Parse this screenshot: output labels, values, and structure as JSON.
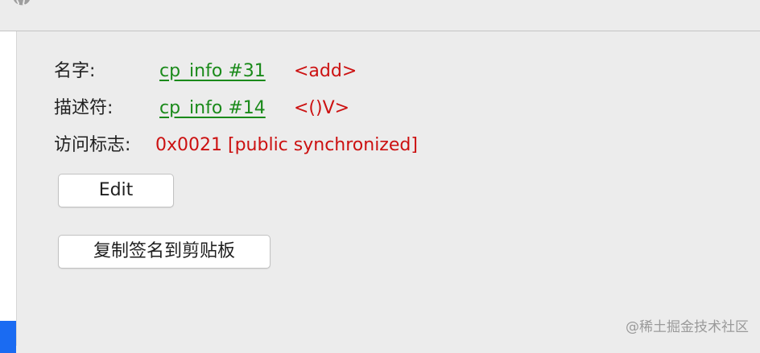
{
  "fields": {
    "name": {
      "label": "名字:",
      "link": "cp_info #31",
      "value": "<add>"
    },
    "descriptor": {
      "label": "描述符:",
      "link": "cp_info #14",
      "value": "<()V>"
    },
    "access_flags": {
      "label": "访问标志:",
      "value": "0x0021 [public synchronized]"
    }
  },
  "buttons": {
    "edit": "Edit",
    "copy_signature": "复制签名到剪贴板"
  },
  "watermark": "@稀土掘金技术社区",
  "colors": {
    "link": "#1a8a1a",
    "value": "#cc1111",
    "selection": "#1a6bf2"
  }
}
